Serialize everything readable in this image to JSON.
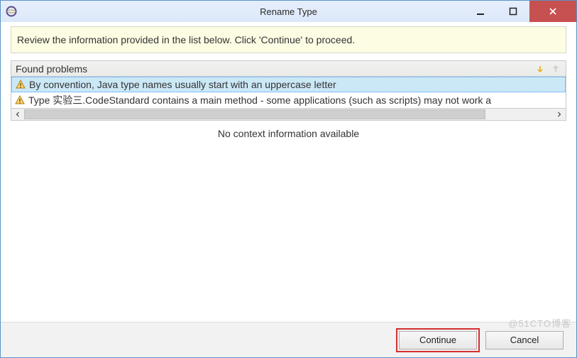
{
  "window": {
    "title": "Rename Type"
  },
  "info_panel": {
    "text": "Review the information provided in the list below. Click 'Continue' to proceed."
  },
  "problems": {
    "header": "Found problems",
    "items": [
      {
        "text": "By convention, Java type names usually start with an uppercase letter",
        "selected": true
      },
      {
        "text": "Type 实验三.CodeStandard contains a main method - some applications (such as scripts) may not work a",
        "selected": false
      }
    ]
  },
  "context_message": "No context information available",
  "buttons": {
    "continue": "Continue",
    "cancel": "Cancel"
  },
  "watermark": "@51CTO博客"
}
